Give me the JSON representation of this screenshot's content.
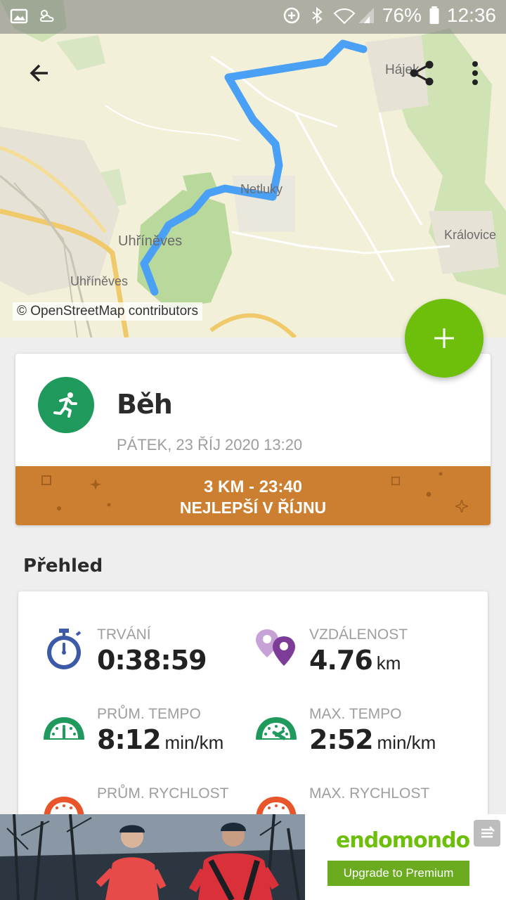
{
  "status_bar": {
    "battery": "76%",
    "time": "12:36"
  },
  "map": {
    "labels": {
      "hajek": "Hájek",
      "netluky": "Netluky",
      "uhrineves_1": "Uhříněves",
      "uhrineves_2": "Uhříněves",
      "kralovice": "Královice"
    },
    "credit": "© OpenStreetMap contributors",
    "route_color": "#4aa0f5"
  },
  "toolbar": {
    "back_icon": "arrow-back-icon",
    "share_icon": "share-icon",
    "menu_icon": "more-vert-icon"
  },
  "fab": {
    "icon": "plus-icon",
    "color": "#6dbf0b"
  },
  "workout": {
    "sport": "Běh",
    "sport_icon": "running-icon",
    "date": "PÁTEK, 23 ŘÍJ 2020 13:20",
    "record_line1": "3 KM  -  23:40",
    "record_line2": "NEJLEPŠÍ V ŘÍJNU",
    "banner_color": "#cc7f30"
  },
  "overview": {
    "title": "Přehled",
    "stats": [
      {
        "label": "TRVÁNÍ",
        "value": "0:38:59",
        "unit": "",
        "icon": "stopwatch-icon"
      },
      {
        "label": "VZDÁLENOST",
        "value": "4.76",
        "unit": "km",
        "icon": "location-pins-icon"
      },
      {
        "label": "PRŮM. TEMPO",
        "value": "8:12",
        "unit": "min/km",
        "icon": "speedometer-green-icon"
      },
      {
        "label": "MAX. TEMPO",
        "value": "2:52",
        "unit": "min/km",
        "icon": "speedometer-green-icon"
      },
      {
        "label": "PRŮM. RYCHLOST",
        "value": "",
        "unit": "",
        "icon": "speedometer-orange-icon"
      },
      {
        "label": "MAX. RYCHLOST",
        "value": "",
        "unit": "",
        "icon": "speedometer-orange-icon"
      }
    ]
  },
  "ad": {
    "brand": "endomondo",
    "cta": "Upgrade to Premium"
  }
}
